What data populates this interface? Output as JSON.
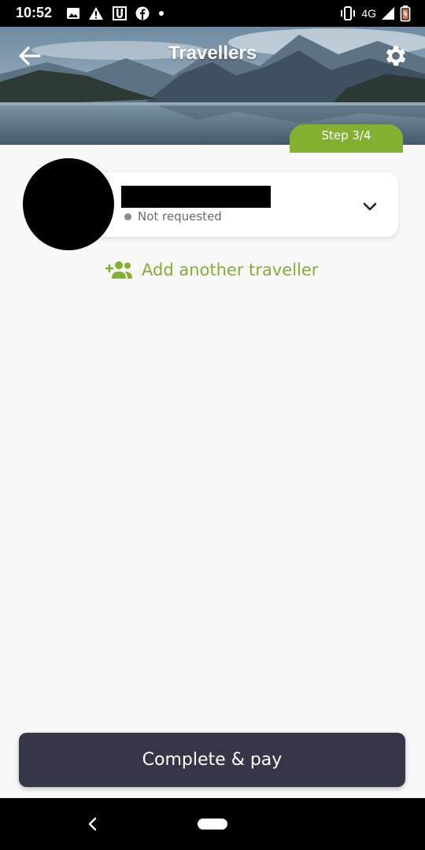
{
  "status_bar": {
    "time": "10:52",
    "network": "4G",
    "icons": [
      "image-icon",
      "warning-icon",
      "u-app-icon",
      "facebook-icon",
      "dot-icon",
      "vibrate-icon",
      "signal-icon",
      "battery-icon"
    ]
  },
  "header": {
    "title": "Travellers",
    "step_label": "Step 3/4",
    "back_icon": "back-arrow-icon",
    "settings_icon": "gear-icon"
  },
  "traveller": {
    "status_label": "Not requested",
    "expand_icon": "chevron-down-icon"
  },
  "add_traveller": {
    "label": "Add another traveller",
    "icon": "add-person-icon"
  },
  "footer": {
    "pay_label": "Complete & pay"
  },
  "colors": {
    "accent_green": "#84b02f",
    "button_dark": "#363649",
    "background": "#f8f8f8"
  }
}
